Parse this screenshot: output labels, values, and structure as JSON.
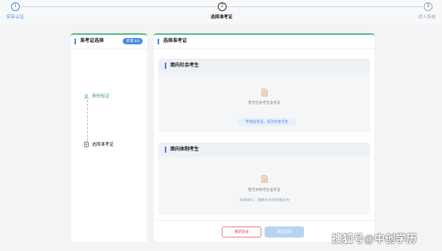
{
  "steps": [
    {
      "number": "1",
      "label": "实名认证"
    },
    {
      "number": "2",
      "label": "选择准考证"
    },
    {
      "number": "3",
      "label": "进入系统"
    }
  ],
  "left_panel": {
    "title": "准考证选择",
    "badge": "步骤 2/3",
    "items": [
      {
        "label": "身份验证",
        "status": "done"
      },
      {
        "label": "选择准考证",
        "status": "current"
      }
    ]
  },
  "right_panel": {
    "title": "选择准考证",
    "sections": [
      {
        "title": "面向社会考生",
        "empty_text": "暂无社会考生准考证",
        "action_label": "申请准考证，成为社会考生"
      },
      {
        "title": "面向体制考生",
        "empty_text": "暂无体制考生准考证",
        "hint": "如有疑问，请联系你的所属机构"
      }
    ]
  },
  "footer": {
    "prev_label": "重新登录",
    "confirm_label": "确认选择"
  },
  "watermark": "搜狐号@中创学历",
  "colors": {
    "accent": "#4a8be6",
    "success": "#4a9e5c",
    "card_top_border": "#5ac08f",
    "danger": "#d9534f"
  }
}
